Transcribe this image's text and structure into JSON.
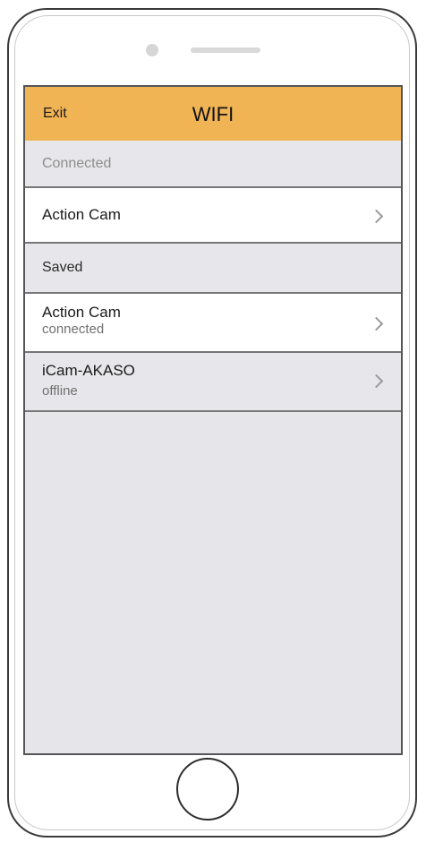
{
  "header": {
    "exit_label": "Exit",
    "title": "WIFI",
    "color": "#f0b455"
  },
  "connected_section": {
    "label": "Connected",
    "items": [
      {
        "name": "Action Cam",
        "chevron": "chevron-right-icon"
      }
    ]
  },
  "saved_section": {
    "label": "Saved",
    "items": [
      {
        "name": "Action Cam",
        "status": "connected",
        "chevron": "chevron-right-icon"
      },
      {
        "name": "iCam-AKASO",
        "status": "offline",
        "chevron": "chevron-right-icon"
      }
    ]
  },
  "device": {
    "camera_icon": "camera-dot",
    "speaker_icon": "speaker-slit",
    "home_button": "home-button"
  }
}
